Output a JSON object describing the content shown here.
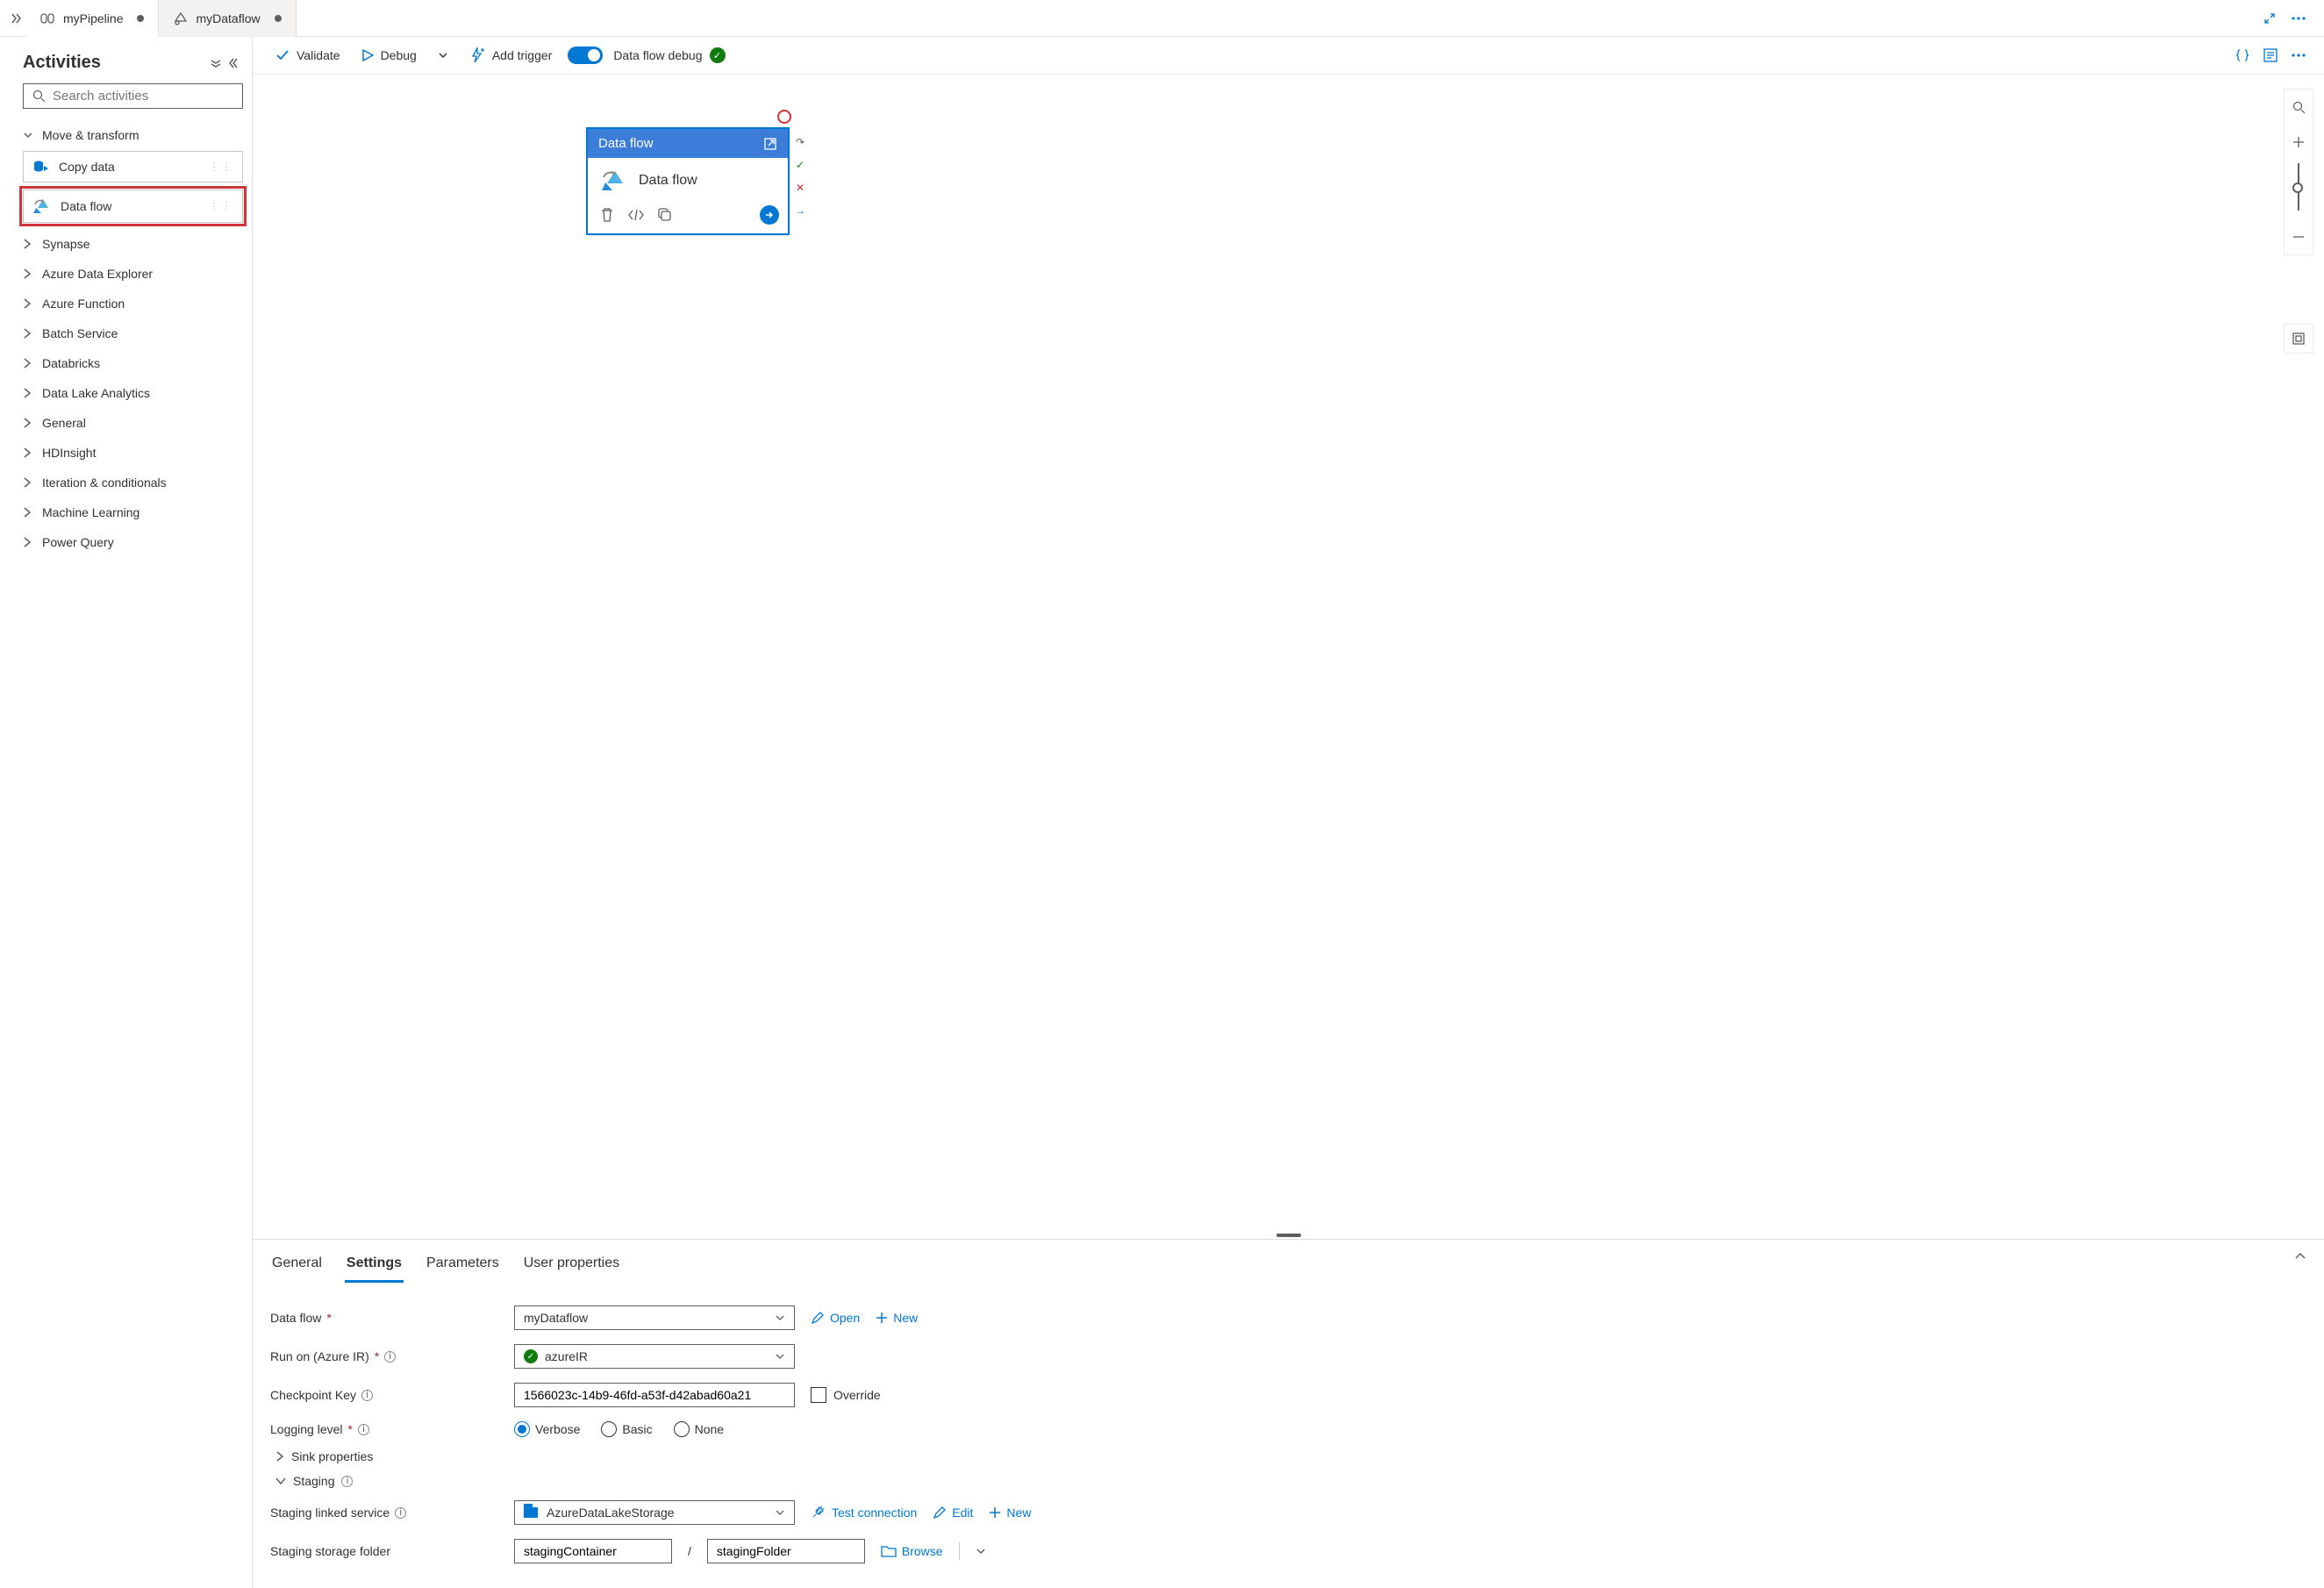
{
  "tabs": {
    "items": [
      {
        "label": "myPipeline",
        "active": true
      },
      {
        "label": "myDataflow",
        "active": false
      }
    ]
  },
  "sidebar": {
    "title": "Activities",
    "search_placeholder": "Search activities",
    "expanded_category": "Move & transform",
    "draggables": [
      {
        "label": "Copy data"
      },
      {
        "label": "Data flow"
      }
    ],
    "categories": [
      "Synapse",
      "Azure Data Explorer",
      "Azure Function",
      "Batch Service",
      "Databricks",
      "Data Lake Analytics",
      "General",
      "HDInsight",
      "Iteration & conditionals",
      "Machine Learning",
      "Power Query"
    ]
  },
  "toolbar": {
    "validate": "Validate",
    "debug": "Debug",
    "add_trigger": "Add trigger",
    "dataflow_debug": "Data flow debug"
  },
  "canvas_node": {
    "header": "Data flow",
    "body": "Data flow"
  },
  "panel": {
    "tabs": [
      "General",
      "Settings",
      "Parameters",
      "User properties"
    ],
    "active_tab": 1,
    "form": {
      "dataflow_label": "Data flow",
      "dataflow_value": "myDataflow",
      "open": "Open",
      "new": "New",
      "runon_label": "Run on (Azure IR)",
      "runon_value": "azureIR",
      "checkpoint_label": "Checkpoint Key",
      "checkpoint_value": "1566023c-14b9-46fd-a53f-d42abad60a21",
      "override": "Override",
      "logging_label": "Logging level",
      "logging_options": [
        "Verbose",
        "Basic",
        "None"
      ],
      "logging_selected": 0,
      "sink_props": "Sink properties",
      "staging": "Staging",
      "staging_linked_label": "Staging linked service",
      "staging_linked_value": "AzureDataLakeStorage",
      "test_connection": "Test connection",
      "edit": "Edit",
      "staging_folder_label": "Staging storage folder",
      "staging_container": "stagingContainer",
      "staging_folder": "stagingFolder",
      "browse": "Browse"
    }
  }
}
